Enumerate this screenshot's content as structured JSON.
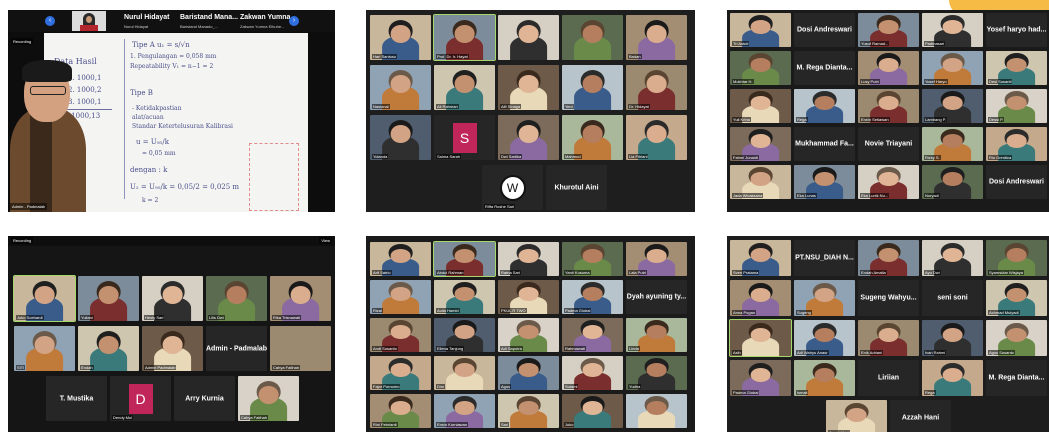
{
  "panels": {
    "p1": {
      "top_strip": {
        "prev_icon": "chevron-left-icon",
        "next_icon": "chevron-right-icon",
        "names": [
          "Nurul Hidayat",
          "Baristand Mana...",
          "Zakwan Yumna..."
        ],
        "subnames": [
          "Nurul Hidayat",
          "Baristand Manado_...",
          "Zakwan Yumna Elhuhe..."
        ]
      },
      "recording": "Recording",
      "speaker_name": "Admin - Padmalab",
      "whiteboard": {
        "l1": "Data Hasil",
        "l2": "1. 1000,1",
        "l3": "2. 1000,2",
        "l4": "3. 1000,1",
        "l5": "X̄ 1000,13",
        "r1": "Tipe A  u₁ = s/√n",
        "r2": "1. Pengulangan   = 0,058 mm",
        "r3": "   Repeatability  V₁ = n−1 = 2",
        "r4": "Tipe B",
        "r5": "- Ketidakpastian",
        "r6": "  alat/acuan",
        "r7": "  Standar Ketertelusuran  Kalibrasi",
        "r8": "u = U₉₅/k",
        "r9": "  = 0,05 mm",
        "r10": "dengan : k",
        "r11": "U₂ = U₉₅/k = 0,05/2 = 0,025 m",
        "r12": "k = 2"
      }
    },
    "p2": {
      "tiles": [
        "Hari Santoso",
        "Prof. Dr. Ir. Hayat",
        "",
        "",
        "Badan",
        "Nasional",
        "Ali Rahman",
        "Alfi Sinaga",
        "Yeni",
        "Dr. Hidayat",
        "Yolanda",
        "Adrian",
        "Dwi Sartika",
        "Mahmud",
        "Lia Fitriani",
        "Indah Lestari",
        "Ari Susanti",
        "Mabrukoh",
        "Rahma Sari",
        "Dedi Irawan",
        "Muhammad Taufik Hendra",
        "Cahya Fatihah",
        "Riffa Roshe Sari",
        "Khurotul Aini"
      ],
      "letter_tile": {
        "letter": "S",
        "name": "Salma Sarah"
      },
      "w_tile": {
        "letter": "W",
        "name": "Riffa Roshe Sari"
      },
      "big_name": "Khurotul Aini"
    },
    "p3": {
      "names": [
        "Dosi Andreswari",
        "Yosef haryo had...",
        "M. Rega Dianta...",
        "Mukhammad Fa...",
        "Novie Triayani",
        "Dosi Andreswari"
      ],
      "small": [
        "Tri Astuti",
        "Yusuf Ramad...",
        "Padmasari",
        "Mokhtar H.",
        "Lusy Putri",
        "Yosef Haryo",
        "Desi Susanti",
        "Yuli Krina",
        "Rega",
        "Erwin Setiawan",
        "Lambang P.",
        "Dessi P.",
        "Fahmi Junaidi",
        "Rizky S.",
        "Rio Grentica",
        "Jada Wicaksana",
        "Eka Lunas",
        "Eka Lunik Nu...",
        "Nuryadi",
        "Ika Wati",
        "Nur Afiyah"
      ]
    },
    "p4": {
      "recording": "Recording",
      "view": "View",
      "names": [
        "Admin - Padmalab",
        "T. Mustika",
        "Arry Kurnia"
      ],
      "letter_tile": {
        "letter": "D",
        "name": "Dendy Mul"
      },
      "small": [
        "Joko Soehardi",
        "Yuliani",
        "Hesty Sari",
        "Lilis Dwi",
        "Rika Trisnawati",
        "SITI",
        "Endah",
        "Admin Padmalab",
        "Hadi",
        "Cahya Fatihah",
        "T. Mustika",
        "Arry Kurnia"
      ]
    },
    "p5": {
      "names": [
        "Dyah ayuning ty..."
      ],
      "small": [
        "Arif Satrio",
        "Abdul Rahman",
        "Ratna Sari",
        "Yanti Kusuma",
        "Lala Putri",
        "Rizal",
        "Aulia Hamid",
        "PKUL R TWO",
        "Padma Global",
        "Andi Susanto",
        "Ellena Tanjung",
        "Adi Saputra",
        "Rahmawati",
        "Linda",
        "Fajar Purnomo",
        "Dini",
        "Agus",
        "Sutami",
        "Yudha",
        "Rini Febrianti",
        "Erwin Kurniawan",
        "Sari",
        "Joko"
      ]
    },
    "p6": {
      "names": [
        "PT.NSU_DIAH N...",
        "Sugeng Wahyu...",
        "seni soni",
        "Liriian",
        "M. Rega Dianta...",
        "Azzah Hani"
      ],
      "small": [
        "Sven Pratama",
        "Endah Amalia",
        "Ayu Dwi",
        "Syamsidar Wisjaya",
        "Anna Pogan",
        "Sugeng",
        "Achmad Mulyadi",
        "Asih",
        "Adi Wahyu Anasr",
        "Enik Adriani",
        "Ivan Rahmi",
        "Agus Susanto",
        "Padma Global",
        "Ismail",
        "Rega",
        "Azzah Hani"
      ]
    }
  }
}
